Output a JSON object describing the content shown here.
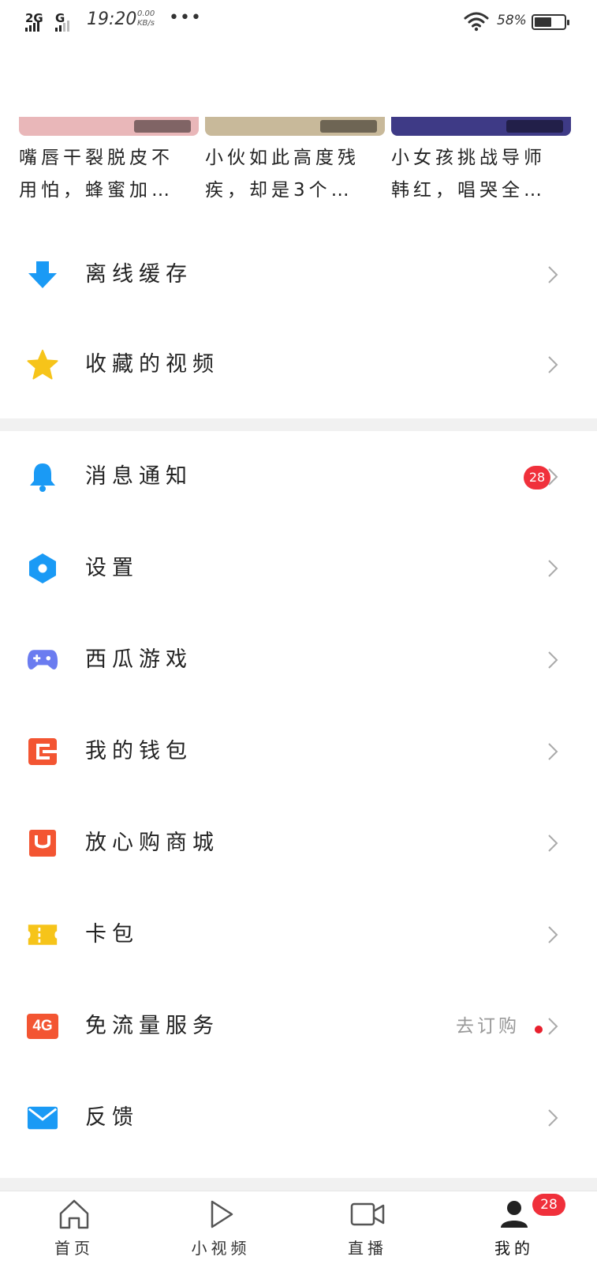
{
  "status_bar": {
    "network_1": "2G",
    "network_2": "G",
    "time": "19:20",
    "speed_value": "0.00",
    "speed_unit": "KB/s",
    "more": "•••",
    "battery_text": "58%",
    "battery_level": 0.58
  },
  "videos": [
    {
      "title_line1": "嘴唇干裂脱皮不",
      "title_line2": "用怕，蜂蜜加…",
      "thumb_color": "#e9b7b9"
    },
    {
      "title_line1": "小伙如此高度残",
      "title_line2": "疾，却是3个…",
      "thumb_color": "#c8b99a"
    },
    {
      "title_line1": "小女孩挑战导师",
      "title_line2": "韩红，唱哭全…",
      "thumb_color": "#3e3a86"
    }
  ],
  "menu": {
    "offline_cache": {
      "label": "离线缓存",
      "icon": "download-arrow-icon",
      "color": "#1a9af5"
    },
    "favorites": {
      "label": "收藏的视频",
      "icon": "star-icon",
      "color": "#f6c41a"
    },
    "notifications": {
      "label": "消息通知",
      "icon": "bell-icon",
      "color": "#1a9af5",
      "badge": "28"
    },
    "settings": {
      "label": "设置",
      "icon": "hexagon-gear-icon",
      "color": "#1a9af5"
    },
    "games": {
      "label": "西瓜游戏",
      "icon": "gamepad-icon",
      "color": "#6b7cf0"
    },
    "wallet": {
      "label": "我的钱包",
      "icon": "wallet-icon",
      "color": "#f35532"
    },
    "shop": {
      "label": "放心购商城",
      "icon": "shopping-bag-icon",
      "color": "#f35532"
    },
    "card_pack": {
      "label": "卡包",
      "icon": "ticket-icon",
      "color": "#f6c41a"
    },
    "free_data": {
      "label": "免流量服务",
      "icon": "4g-icon",
      "icon_text": "4G",
      "color": "#f35532",
      "extra": "去订购"
    },
    "feedback": {
      "label": "反馈",
      "icon": "mail-icon",
      "color": "#1a9af5"
    }
  },
  "bottom_nav": {
    "home": "首页",
    "short_video": "小视频",
    "live": "直播",
    "mine": "我的",
    "mine_badge": "28"
  }
}
